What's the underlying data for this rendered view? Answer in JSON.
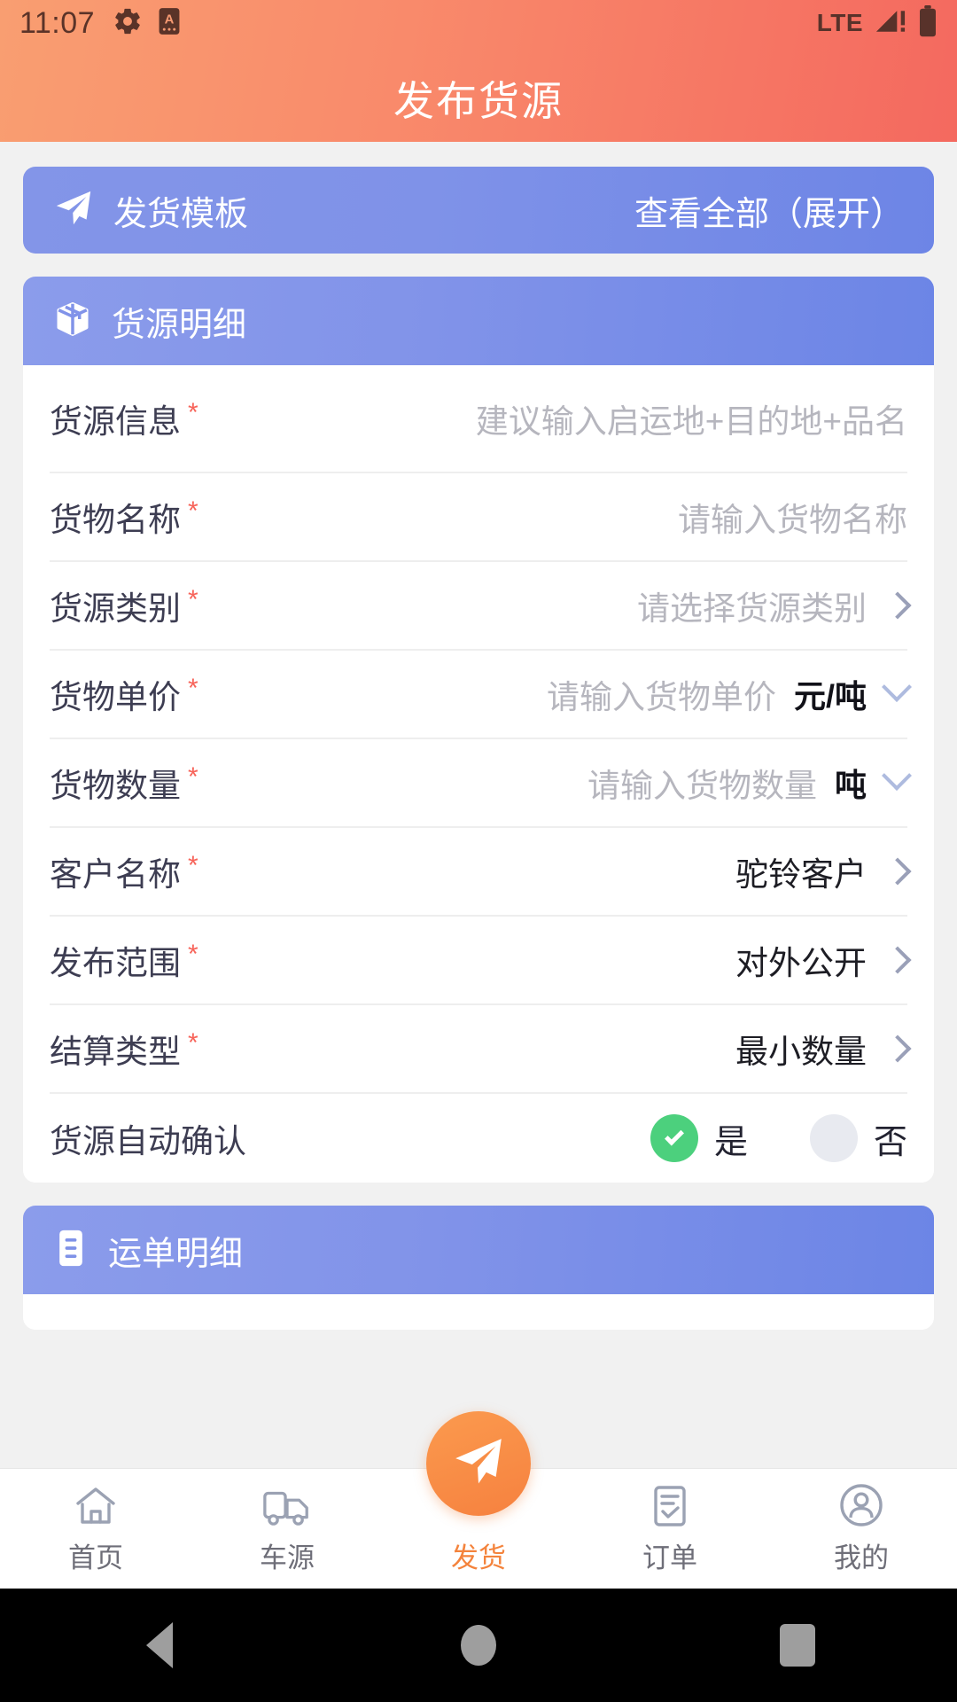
{
  "statusbar": {
    "time": "11:07",
    "icons": [
      "gear-icon",
      "app-badge-icon"
    ],
    "network": "LTE",
    "signal_icon": "signal-bars-icon",
    "battery_icon": "battery-full-icon"
  },
  "header": {
    "title": "发布货源"
  },
  "template_bar": {
    "icon": "paper-plane-icon",
    "label": "发货模板",
    "action": "查看全部（展开）"
  },
  "cargo_section": {
    "icon": "package-box-icon",
    "title": "货源明细",
    "rows": [
      {
        "label": "货源信息",
        "required": "*",
        "placeholder": "建议输入启运地+目的地+品名",
        "type": "input"
      },
      {
        "label": "货物名称",
        "required": "*",
        "placeholder": "请输入货物名称",
        "type": "input"
      },
      {
        "label": "货源类别",
        "required": "*",
        "placeholder": "请选择货源类别",
        "type": "select"
      },
      {
        "label": "货物单价",
        "required": "*",
        "placeholder": "请输入货物单价",
        "unit": "元/吨",
        "type": "input-unit"
      },
      {
        "label": "货物数量",
        "required": "*",
        "placeholder": "请输入货物数量",
        "unit": "吨",
        "type": "input-unit"
      },
      {
        "label": "客户名称",
        "required": "*",
        "value": "驼铃客户",
        "type": "select"
      },
      {
        "label": "发布范围",
        "required": "*",
        "value": "对外公开",
        "type": "select"
      },
      {
        "label": "结算类型",
        "required": "*",
        "value": "最小数量",
        "type": "select"
      }
    ],
    "auto_confirm": {
      "label": "货源自动确认",
      "yes_label": "是",
      "no_label": "否",
      "selected": "是"
    }
  },
  "waybill_section": {
    "icon": "document-list-icon",
    "title": "运单明细"
  },
  "bottom_nav": {
    "items": [
      {
        "label": "首页",
        "icon": "home-icon",
        "active": false
      },
      {
        "label": "车源",
        "icon": "truck-icon",
        "active": false
      },
      {
        "label": "发货",
        "icon": "paper-plane-icon",
        "active": true
      },
      {
        "label": "订单",
        "icon": "order-clipboard-icon",
        "active": false
      },
      {
        "label": "我的",
        "icon": "person-icon",
        "active": false
      }
    ],
    "fab_icon": "paper-plane-icon"
  },
  "android_nav": {
    "back": "back-triangle-icon",
    "home": "home-circle-icon",
    "recents": "recents-square-icon"
  },
  "colors": {
    "header_start": "#f99e71",
    "header_end": "#f4695f",
    "card_blue_start": "#8b9ceb",
    "card_blue_end": "#6c85e6",
    "required_red": "#f7645a",
    "accent_orange": "#f4833c",
    "radio_green": "#4cd07d"
  }
}
